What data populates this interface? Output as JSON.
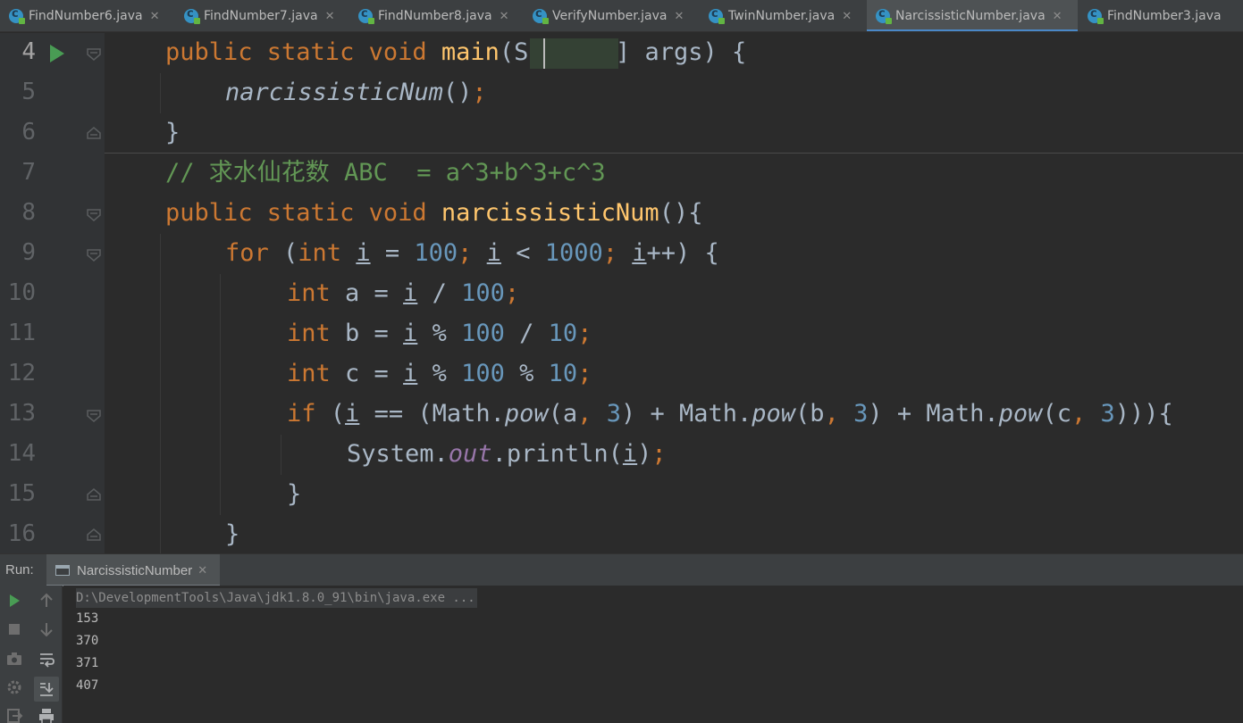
{
  "tabs": [
    {
      "label": "FindNumber6.java",
      "active": false
    },
    {
      "label": "FindNumber7.java",
      "active": false
    },
    {
      "label": "FindNumber8.java",
      "active": false
    },
    {
      "label": "VerifyNumber.java",
      "active": false
    },
    {
      "label": "TwinNumber.java",
      "active": false
    },
    {
      "label": "NarcissisticNumber.java",
      "active": true
    },
    {
      "label": "FindNumber3.java",
      "active": false
    }
  ],
  "editor": {
    "line_numbers": [
      "4",
      "5",
      "6",
      "7",
      "8",
      "9",
      "10",
      "11",
      "12",
      "13",
      "14",
      "15",
      "16"
    ],
    "lines": {
      "l4": {
        "t1": "public static void ",
        "t2": "main",
        "t3": "(",
        "t4": "String",
        "t5": "[] args) {"
      },
      "l5": {
        "t1": "narcissisticNum",
        "t2": "()",
        "t3": ";"
      },
      "l6": {
        "t1": "}"
      },
      "l7": {
        "t1": "// 求水仙花数 ABC  = a^3+b^3+c^3"
      },
      "l8": {
        "t1": "public static void ",
        "t2": "narcissisticNum",
        "t3": "(){"
      },
      "l9": {
        "t1": "for ",
        "t2": "(",
        "t3": "int ",
        "t4": "i",
        "t5": " = ",
        "t6": "100",
        "t7": "; ",
        "t8": "i",
        "t9": " < ",
        "t10": "1000",
        "t11": "; ",
        "t12": "i",
        "t13": "++) {"
      },
      "l10": {
        "t1": "int ",
        "t2": "a = ",
        "t3": "i",
        "t4": " / ",
        "t5": "100",
        "t6": ";"
      },
      "l11": {
        "t1": "int ",
        "t2": "b = ",
        "t3": "i",
        "t4": " % ",
        "t5": "100",
        "t6": " / ",
        "t7": "10",
        "t8": ";"
      },
      "l12": {
        "t1": "int ",
        "t2": "c = ",
        "t3": "i",
        "t4": " % ",
        "t5": "100",
        "t6": " % ",
        "t7": "10",
        "t8": ";"
      },
      "l13": {
        "t1": "if ",
        "t2": "(",
        "t3": "i",
        "t4": " == (Math.",
        "t5": "pow",
        "t6": "(a",
        "t7": ", ",
        "t8": "3",
        "t9": ") + Math.",
        "t10": "pow",
        "t11": "(b",
        "t12": ", ",
        "t13": "3",
        "t14": ") + Math.",
        "t15": "pow",
        "t16": "(c",
        "t17": ", ",
        "t18": "3",
        "t19": "))){"
      },
      "l14": {
        "t1": "System.",
        "t2": "out",
        "t3": ".println(",
        "t4": "i",
        "t5": ")",
        "t6": ";"
      },
      "l15": {
        "t1": "}"
      },
      "l16": {
        "t1": "}"
      }
    }
  },
  "run_panel": {
    "label": "Run:",
    "tab_label": "NarcissisticNumber",
    "command": "D:\\DevelopmentTools\\Java\\jdk1.8.0_91\\bin\\java.exe ...",
    "output": [
      "153",
      "370",
      "371",
      "407"
    ]
  },
  "colors": {
    "keyword": "#cc7832",
    "method_decl": "#ffc66d",
    "number": "#6897bb",
    "comment": "#629755",
    "static_field": "#9876aa",
    "run_green": "#499c54",
    "active_tab_underline": "#4a88c7"
  },
  "icons": {
    "tab": "java-class-icon",
    "gutter_run": "run-gutter-icon",
    "fold": "fold-icon",
    "toolbar": [
      "run-icon",
      "up-arrow-icon",
      "stop-icon",
      "down-arrow-icon",
      "camera-icon",
      "soft-wrap-icon",
      "scroll-to-end-icon",
      "print-icon",
      "settings-icon",
      "exit-icon"
    ]
  }
}
